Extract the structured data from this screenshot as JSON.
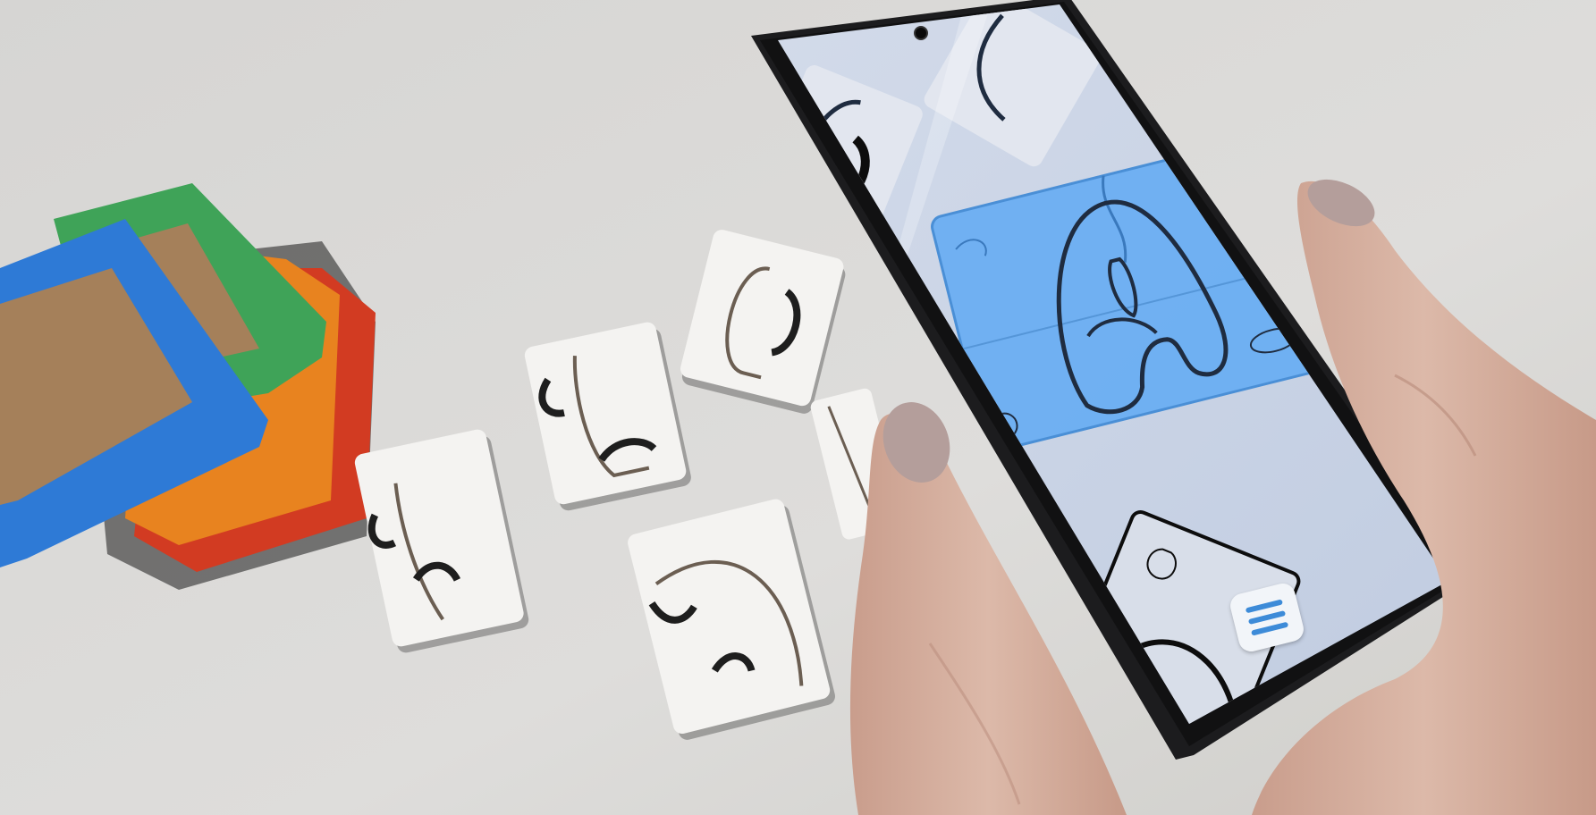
{
  "scene": {
    "description_colors": {
      "table": "#d9d8d6",
      "frame_blue": "#2e7ad6",
      "frame_green": "#3fa358",
      "frame_red": "#d23b22",
      "frame_orange": "#e8831f",
      "cork": "#a5805a",
      "piece": "#f4f3f1",
      "screen": "#c8d3e6",
      "highlight": "#6aaef2",
      "outline": "#1f2c40",
      "phone_body": "#1c1c1e",
      "skin": "#d7b3a3",
      "nail": "#b49e9b"
    }
  },
  "app": {
    "highlighted_letter": "A",
    "menu_icon": "hamburger-menu-icon",
    "accent": "#3d8bd8"
  }
}
